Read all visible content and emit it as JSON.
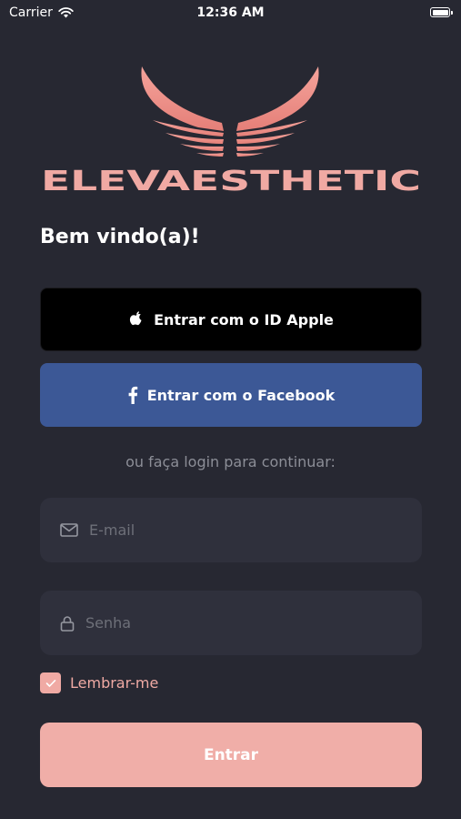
{
  "status_bar": {
    "carrier": "Carrier",
    "time": "12:36 AM"
  },
  "brand": {
    "name": "ELEVAESTHETIC",
    "color": "#f0a9a3"
  },
  "welcome": "Bem vindo(a)!",
  "buttons": {
    "apple": "Entrar com o ID Apple",
    "facebook": "Entrar com o Facebook",
    "submit": "Entrar"
  },
  "divider_text": "ou faça login para continuar:",
  "fields": {
    "email": {
      "placeholder": "E-mail",
      "value": "",
      "icon": "mail-icon"
    },
    "password": {
      "placeholder": "Senha",
      "value": "",
      "icon": "lock-icon"
    }
  },
  "remember_me": {
    "label": "Lembrar-me",
    "checked": true
  },
  "colors": {
    "background": "#272832",
    "field_background": "#2f303c",
    "apple_button": "#000000",
    "facebook_button": "#3c5896",
    "accent": "#f0aea8"
  }
}
